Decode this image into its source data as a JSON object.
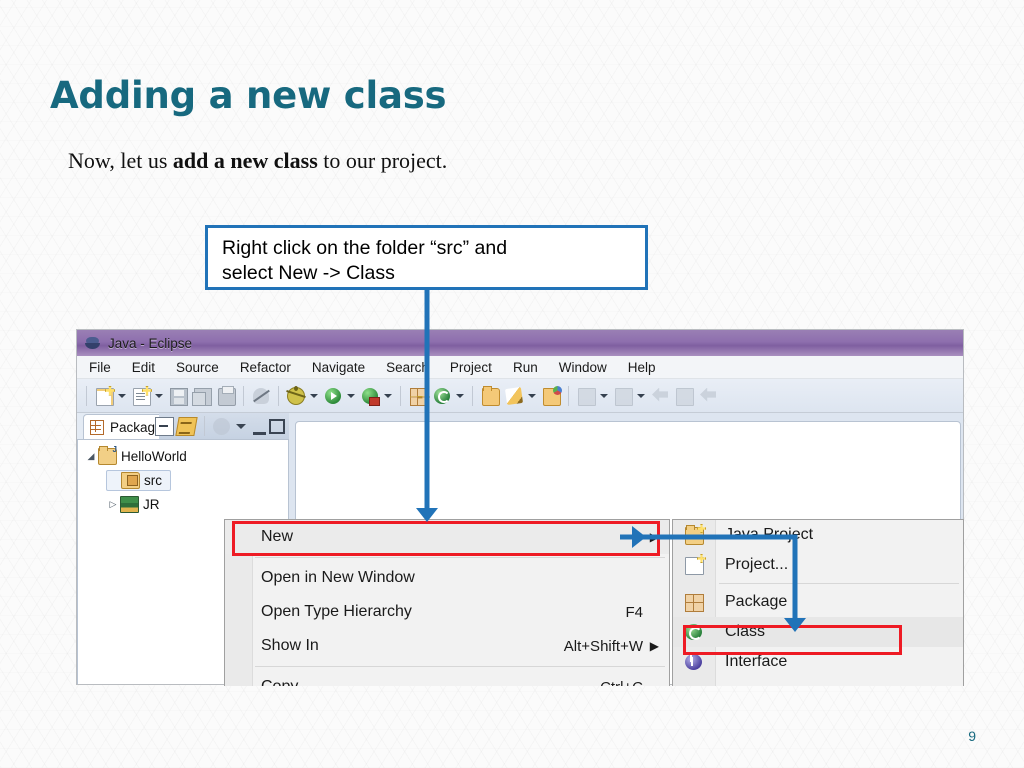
{
  "slide": {
    "title": "Adding a new class",
    "subtitle_prefix": "Now, let us ",
    "subtitle_bold": "add a new class",
    "subtitle_suffix": " to our project.",
    "page_number": "9",
    "title_color": "#17697F"
  },
  "callout": {
    "line1": "Right click on the folder “src” and",
    "line2": "select New -> Class",
    "border_color": "#2173B8"
  },
  "annotation": {
    "highlight_color": "#EE1B24",
    "arrow_color": "#2173B8"
  },
  "eclipse": {
    "titlebar": {
      "title": "Java - Eclipse",
      "icon": "eclipse-logo"
    },
    "menubar": [
      "File",
      "Edit",
      "Source",
      "Refactor",
      "Navigate",
      "Search",
      "Project",
      "Run",
      "Window",
      "Help"
    ],
    "toolbar": [
      {
        "name": "new-file-button",
        "icon": "new-file-icon",
        "caret": true
      },
      {
        "name": "new-item-button",
        "icon": "new-item-icon",
        "caret": true
      },
      {
        "name": "save-button",
        "icon": "save-icon",
        "caret": false
      },
      {
        "name": "save-all-button",
        "icon": "save-all-icon",
        "caret": false
      },
      {
        "name": "print-button",
        "icon": "print-icon",
        "caret": false
      },
      {
        "sep": true
      },
      {
        "name": "toggle-mark-occurrences-button",
        "icon": "strike-icon",
        "caret": false
      },
      {
        "sep": true
      },
      {
        "name": "debug-button",
        "icon": "bug-icon",
        "caret": true
      },
      {
        "name": "run-button",
        "icon": "run-icon",
        "caret": true
      },
      {
        "name": "external-tools-button",
        "icon": "run-config-icon",
        "caret": true
      },
      {
        "sep": true
      },
      {
        "name": "new-package-button",
        "icon": "package-icon",
        "caret": false
      },
      {
        "name": "new-class-button",
        "icon": "class-icon",
        "caret": true
      },
      {
        "sep": true
      },
      {
        "name": "open-type-button",
        "icon": "folder-icon",
        "caret": false
      },
      {
        "name": "open-task-button",
        "icon": "pencil-icon",
        "caret": true
      },
      {
        "name": "open-resource-button",
        "icon": "folder-color-icon",
        "caret": false
      },
      {
        "sep": true
      },
      {
        "name": "next-annotation-button",
        "icon": "next-annotation-icon",
        "caret": true
      },
      {
        "name": "previous-annotation-button",
        "icon": "previous-annotation-icon",
        "caret": true
      },
      {
        "name": "back-button",
        "icon": "back-arrow-icon",
        "caret": false
      },
      {
        "name": "forward-button",
        "icon": "forward-arrow-icon",
        "caret": false
      },
      {
        "name": "last-edit-button",
        "icon": "last-edit-icon",
        "caret": false
      }
    ],
    "package_explorer": {
      "tab_label": "Package Explorer",
      "tab_icon": "package-explorer-icon",
      "close_icon": "close-icon",
      "view_buttons": [
        {
          "name": "collapse-all-button",
          "icon": "collapse-all-icon"
        },
        {
          "name": "link-with-editor-button",
          "icon": "link-with-editor-icon"
        },
        {
          "name": "focus-on-active-task-button",
          "icon": "focus-task-icon"
        },
        {
          "name": "view-menu-button",
          "icon": "chevron-down-icon"
        },
        {
          "name": "minimize-button",
          "icon": "minimize-icon"
        },
        {
          "name": "maximize-button",
          "icon": "maximize-icon"
        }
      ],
      "tree": [
        {
          "label": "HelloWorld",
          "icon": "java-project-icon",
          "depth": 0,
          "twisty": "◢",
          "selected": false
        },
        {
          "label": "src",
          "icon": "source-folder-icon",
          "depth": 1,
          "twisty": "",
          "selected": true
        },
        {
          "label": "JR",
          "icon": "jre-library-icon",
          "depth": 1,
          "twisty": "▷",
          "selected": false
        }
      ]
    },
    "context_menu": {
      "items": [
        {
          "label": "New",
          "accel": "",
          "submenu": true,
          "highlighted": true
        },
        {
          "sep": true
        },
        {
          "label": "Open in New Window",
          "accel": "",
          "submenu": false
        },
        {
          "label": "Open Type Hierarchy",
          "accel": "F4",
          "submenu": false
        },
        {
          "label": "Show In",
          "accel": "Alt+Shift+W",
          "submenu": true
        },
        {
          "sep": true
        },
        {
          "label": "Copy",
          "accel": "Ctrl+C",
          "submenu": false
        }
      ]
    },
    "submenu": {
      "items": [
        {
          "label": "Java Project",
          "icon": "java-project-icon",
          "selected": false
        },
        {
          "label": "Project...",
          "icon": "project-icon",
          "selected": false
        },
        {
          "sep": true
        },
        {
          "label": "Package",
          "icon": "package-icon",
          "selected": false
        },
        {
          "label": "Class",
          "icon": "class-icon",
          "selected": true
        },
        {
          "label": "Interface",
          "icon": "interface-icon",
          "selected": false
        }
      ]
    }
  }
}
